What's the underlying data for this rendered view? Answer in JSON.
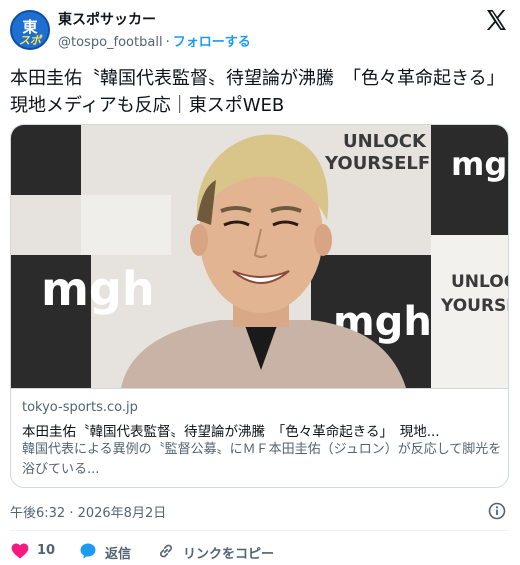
{
  "account": {
    "name": "東スポサッカー",
    "handle": "@tospo_football",
    "separator": "·",
    "follow_label": "フォローする",
    "avatar_text_top": "東",
    "avatar_text_bottom": "スポ"
  },
  "tweet": {
    "text": "本田圭佑〝韓国代表監督〟待望論が沸騰　「色々革命起きる」　現地メディアも反応｜東スポWEB"
  },
  "card": {
    "domain": "tokyo-sports.co.jp",
    "title": "本田圭佑〝韓国代表監督〟待望論が沸騰　「色々革命起きる」　現地...",
    "description": "韓国代表による異例の〝監督公募〟にＭＦ本田圭佑（ジュロン）が反応して脚光を浴びている...",
    "image_backdrop_texts": [
      "mgh",
      "UNLOCK",
      "YOURSELF"
    ]
  },
  "meta": {
    "timestamp": "午後6:32 · 2026年8月2日"
  },
  "actions": {
    "like_count": "10",
    "reply_label": "返信",
    "copy_link_label": "リンクをコピー"
  },
  "colors": {
    "accent": "#1d9bf0",
    "like": "#f91880",
    "muted": "#536471",
    "text": "#0f1419"
  }
}
